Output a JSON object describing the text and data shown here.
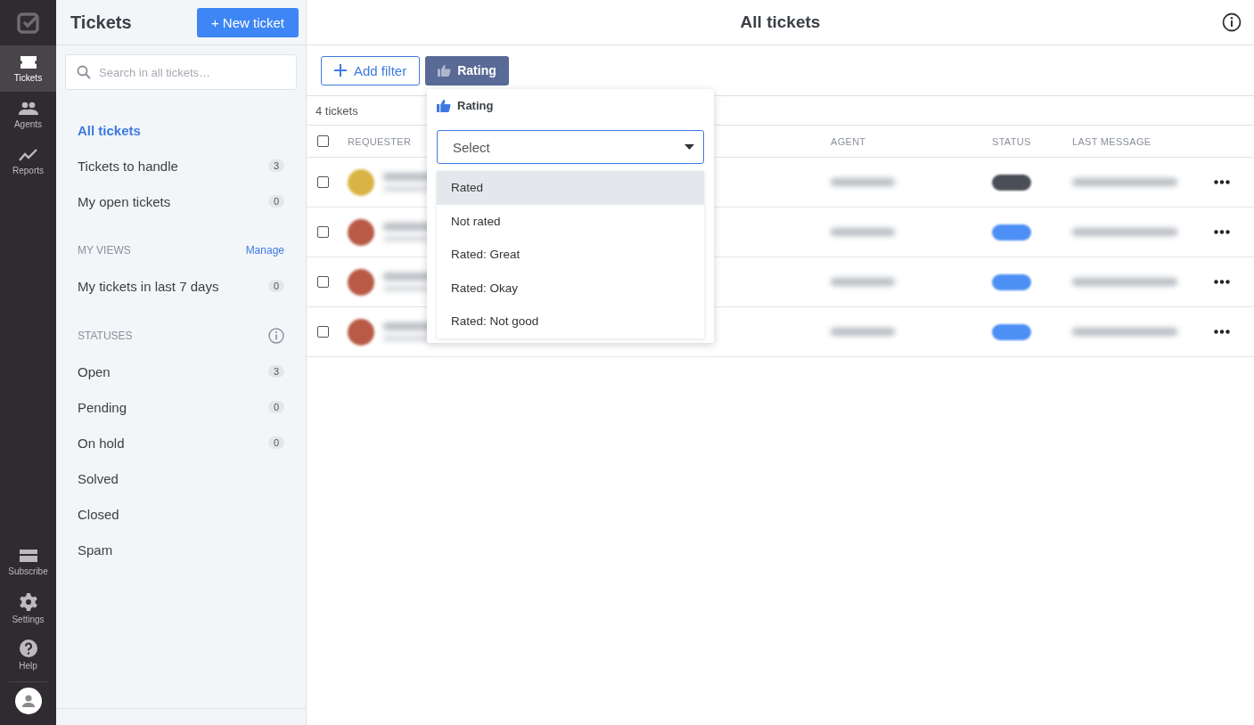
{
  "rail": {
    "items": [
      {
        "kind": "tickets",
        "label": "Tickets",
        "selected": true
      },
      {
        "kind": "agents",
        "label": "Agents",
        "selected": false
      },
      {
        "kind": "reports",
        "label": "Reports",
        "selected": false
      }
    ],
    "bottom_items": [
      {
        "kind": "subscribe",
        "label": "Subscribe"
      },
      {
        "kind": "settings",
        "label": "Settings"
      },
      {
        "kind": "help",
        "label": "Help"
      }
    ]
  },
  "sidebar": {
    "title": "Tickets",
    "new_button": "+ New ticket",
    "search": {
      "placeholder": "Search in all tickets…"
    },
    "views": [
      {
        "label": "All tickets",
        "selected": true
      },
      {
        "label": "Tickets to handle",
        "count": "3",
        "selected": false
      },
      {
        "label": "My open tickets",
        "count": "0",
        "selected": false
      }
    ],
    "my_views": {
      "heading": "MY VIEWS",
      "manage": "Manage",
      "items": [
        {
          "label": "My tickets in last 7 days",
          "count": "0",
          "selected": false
        }
      ]
    },
    "statuses": {
      "heading": "STATUSES",
      "items": [
        {
          "label": "Open",
          "count": "3",
          "selected": false
        },
        {
          "label": "Pending",
          "count": "0",
          "selected": false
        },
        {
          "label": "On hold",
          "count": "0",
          "selected": false
        },
        {
          "label": "Solved",
          "selected": false
        },
        {
          "label": "Closed",
          "selected": false
        },
        {
          "label": "Spam",
          "selected": false
        }
      ]
    }
  },
  "main": {
    "title": "All tickets",
    "add_filter": "Add filter",
    "active_filter": "Rating",
    "count": "4 tickets",
    "select_all": {
      "checked": false
    },
    "columns": [
      {
        "label": "REQUESTER"
      },
      {
        "label": "AGENT"
      },
      {
        "label": "STATUS"
      },
      {
        "label": "LAST MESSAGE"
      }
    ],
    "rows": [
      {
        "checked": false,
        "avatar": {
          "color": "#d9b444"
        },
        "status": {
          "color": "#4a4f57"
        }
      },
      {
        "checked": false,
        "avatar": {
          "color": "#b85a45"
        },
        "status": {
          "color": "#4c8ff5"
        }
      },
      {
        "checked": false,
        "avatar": {
          "color": "#b85a45"
        },
        "status": {
          "color": "#4c8ff5"
        }
      },
      {
        "checked": false,
        "avatar": {
          "color": "#b85a45"
        },
        "status": {
          "color": "#4c8ff5"
        }
      }
    ]
  },
  "rating_dropdown": {
    "title": "Rating",
    "placeholder": "Select",
    "options": [
      {
        "label": "Rated",
        "selected": true
      },
      {
        "label": "Not rated",
        "selected": false
      },
      {
        "label": "Rated: Great",
        "selected": false
      },
      {
        "label": "Rated: Okay",
        "selected": false
      },
      {
        "label": "Rated: Not good",
        "selected": false
      }
    ]
  }
}
